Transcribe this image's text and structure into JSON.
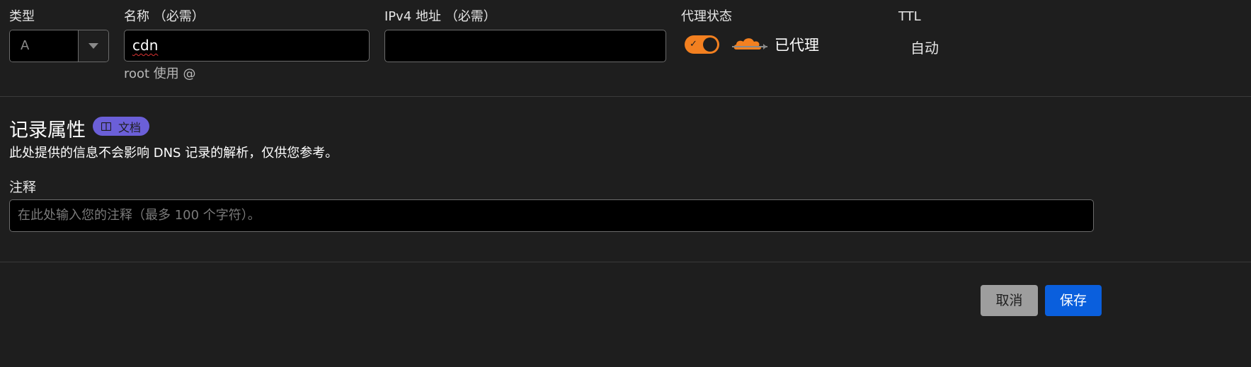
{
  "labels": {
    "type": "类型",
    "name": "名称 （必需）",
    "ipv4": "IPv4 地址 （必需）",
    "proxy_status": "代理状态",
    "ttl": "TTL"
  },
  "type_select": {
    "value": "A"
  },
  "name_input": {
    "value": "cdn"
  },
  "name_hint": "root 使用 @",
  "ipv4_input": {
    "value": ""
  },
  "proxy": {
    "enabled": true,
    "status_text": "已代理",
    "accent": "#f38020"
  },
  "ttl": {
    "value": "自动"
  },
  "record_attributes": {
    "title": "记录属性",
    "doc_badge": "文档",
    "description": "此处提供的信息不会影响 DNS 记录的解析，仅供您参考。",
    "comment_label": "注释",
    "comment_placeholder": "在此处输入您的注释（最多 100 个字符）。"
  },
  "actions": {
    "cancel": "取消",
    "save": "保存",
    "save_color": "#0a5fdd"
  },
  "icons": [
    "chevron-down-icon",
    "check-icon",
    "cloud-icon",
    "book-icon"
  ]
}
